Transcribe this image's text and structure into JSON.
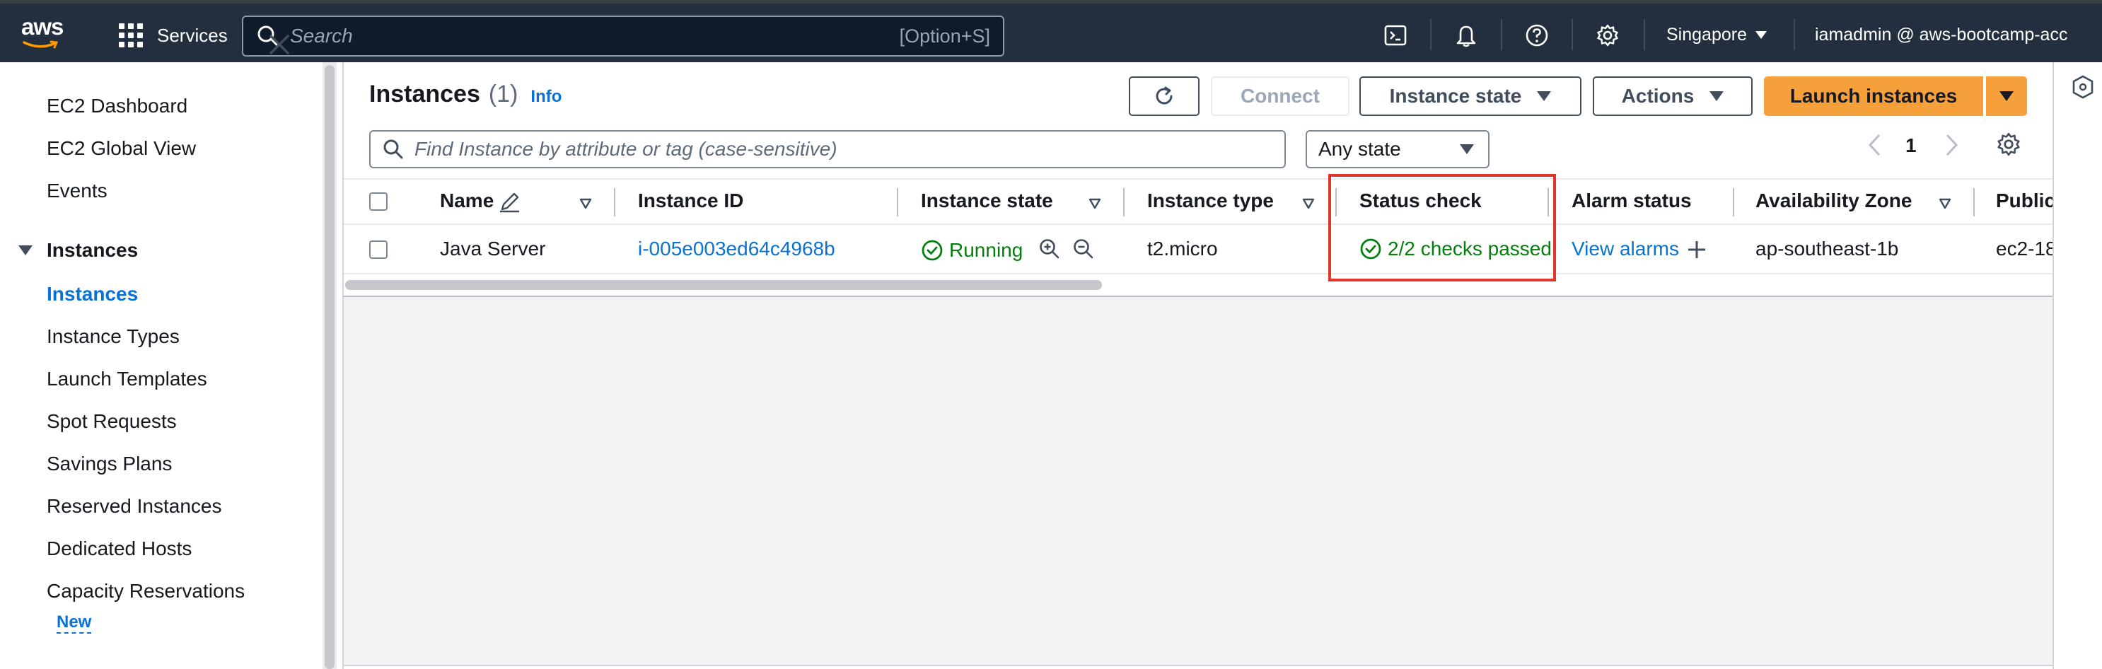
{
  "topbar": {
    "logo_text": "aws",
    "services_label": "Services",
    "search_placeholder": "Search",
    "search_shortcut": "[Option+S]",
    "region": "Singapore",
    "account": "iamadmin @ aws-bootcamp-acc"
  },
  "sidebar": {
    "items_top": [
      "EC2 Dashboard",
      "EC2 Global View",
      "Events"
    ],
    "section_title": "Instances",
    "section_items": [
      "Instances",
      "Instance Types",
      "Launch Templates",
      "Spot Requests",
      "Savings Plans",
      "Reserved Instances",
      "Dedicated Hosts",
      "Capacity Reservations"
    ],
    "new_badge": "New",
    "active_item": "Instances"
  },
  "main": {
    "title": "Instances",
    "count": "(1)",
    "info": "Info",
    "buttons": {
      "connect": "Connect",
      "instance_state": "Instance state",
      "actions": "Actions",
      "launch": "Launch instances"
    },
    "find_placeholder": "Find Instance by attribute or tag (case-sensitive)",
    "state_filter": "Any state",
    "page_number": "1"
  },
  "table": {
    "columns": [
      "Name",
      "Instance ID",
      "Instance state",
      "Instance type",
      "Status check",
      "Alarm status",
      "Availability Zone",
      "Public"
    ],
    "rows": [
      {
        "name": "Java Server",
        "instance_id": "i-005e003ed64c4968b",
        "state": "Running",
        "type": "t2.micro",
        "status_check": "2/2 checks passed",
        "alarm": "View alarms",
        "az": "ap-southeast-1b",
        "public": "ec2-18"
      }
    ]
  },
  "colors": {
    "topbar": "#232f3e",
    "link": "#0972d3",
    "success": "#037f0c",
    "primary_button": "#f5a03a",
    "highlight_box": "#e0362b"
  }
}
